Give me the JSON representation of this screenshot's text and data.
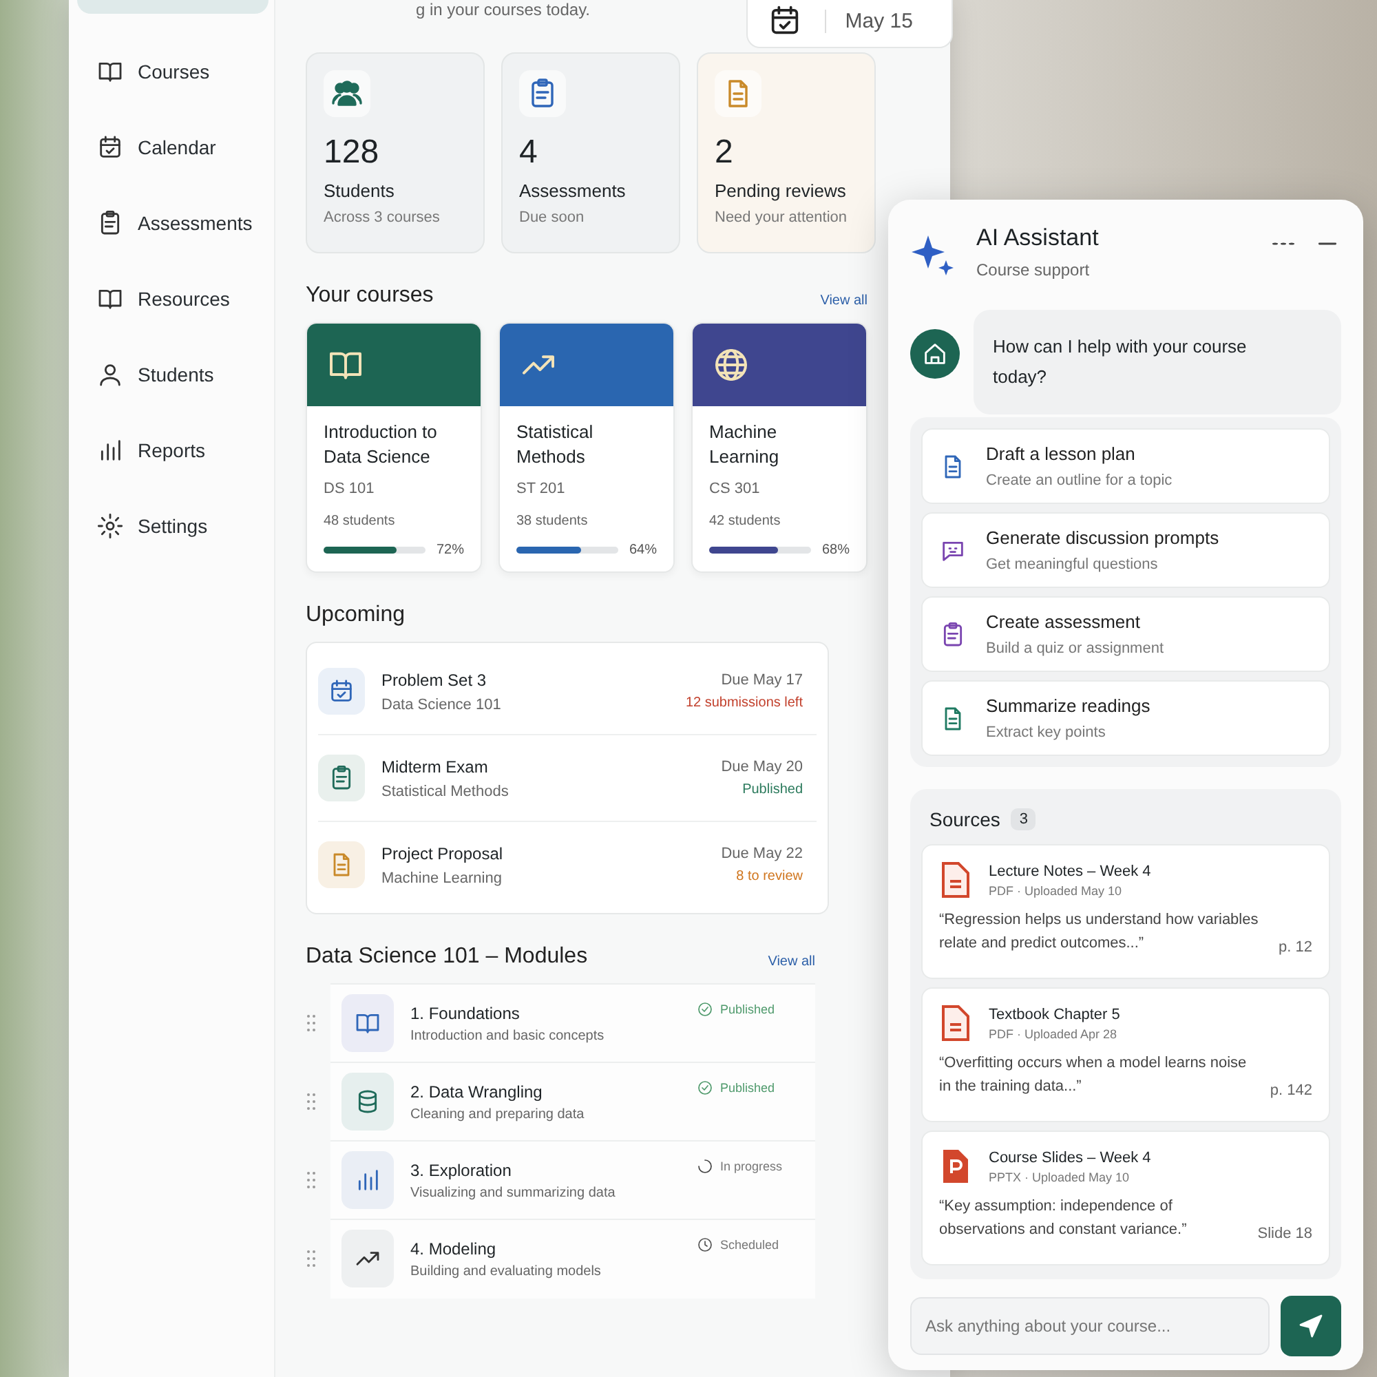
{
  "sidebar": {
    "items": [
      {
        "label": "Courses",
        "selected": false
      },
      {
        "label": "Calendar",
        "selected": false
      },
      {
        "label": "Assessments",
        "selected": false
      },
      {
        "label": "Resources",
        "selected": false
      },
      {
        "label": "Students",
        "selected": false
      },
      {
        "label": "Reports",
        "selected": false
      },
      {
        "label": "Settings",
        "selected": false
      }
    ]
  },
  "header": {
    "subtitle": "g in your courses today.",
    "date": "May 15"
  },
  "stats": [
    {
      "value": "128",
      "label": "Students",
      "note": "Across 3 courses",
      "color": "#1f6b5a"
    },
    {
      "value": "4",
      "label": "Assessments",
      "note": "Due soon",
      "color": "#2f66b8"
    },
    {
      "value": "2",
      "label": "Pending reviews",
      "note": "Need your attention",
      "color": "#c98a2a"
    }
  ],
  "courses": {
    "title": "Your courses",
    "view_all": "View all",
    "items": [
      {
        "title": "Introduction to Data Science",
        "code": "DS 101",
        "students": "48 students",
        "progress": "72%",
        "level": 0.72,
        "color": "#1d6553"
      },
      {
        "title": "Statistical Methods",
        "code": "ST 201",
        "students": "38 students",
        "progress": "64%",
        "level": 0.64,
        "color": "#2a66b0"
      },
      {
        "title": "Machine Learning",
        "code": "CS 301",
        "students": "42 students",
        "progress": "68%",
        "level": 0.68,
        "color": "#3f468f"
      }
    ]
  },
  "upcoming": {
    "title": "Upcoming",
    "items": [
      {
        "title": "Problem Set 3",
        "course": "Data Science 101",
        "due": "Due May 17",
        "note": "12 submissions left",
        "color": "#c2412d"
      },
      {
        "title": "Midterm Exam",
        "course": "Statistical Methods",
        "due": "Due May 20",
        "note": "Published",
        "color": "#2b7a5c"
      },
      {
        "title": "Project Proposal",
        "course": "Machine Learning",
        "due": "Due May 22",
        "note": "8 to review",
        "color": "#d0761f"
      }
    ]
  },
  "modules": {
    "title": "Data Science 101 – Modules",
    "view_all": "View all",
    "items": [
      {
        "title": "1. Foundations",
        "description": "Introduction and basic concepts",
        "status": "Published",
        "kind": "published"
      },
      {
        "title": "2. Data Wrangling",
        "description": "Cleaning and preparing data",
        "status": "Published",
        "kind": "published"
      },
      {
        "title": "3. Exploration",
        "description": "Visualizing and summarizing data",
        "status": "In progress",
        "kind": "progress"
      },
      {
        "title": "4. Modeling",
        "description": "Building and evaluating models",
        "status": "Scheduled",
        "kind": "scheduled"
      }
    ]
  },
  "assistant": {
    "title": "AI Assistant",
    "subtitle": "Course support",
    "message": "How can I help with your course today?",
    "suggestions": [
      {
        "title": "Draft a lesson plan",
        "description": "Create an outline for a topic",
        "color": "#2f66b8"
      },
      {
        "title": "Generate discussion prompts",
        "description": "Get meaningful questions",
        "color": "#7a45b0"
      },
      {
        "title": "Create assessment",
        "description": "Build a quiz or assignment",
        "color": "#7a45b0"
      },
      {
        "title": "Summarize readings",
        "description": "Extract key points",
        "color": "#1f7a62"
      }
    ],
    "sources": {
      "title": "Sources",
      "count": "3",
      "items": [
        {
          "title": "Lecture Notes – Week 4",
          "meta": "PDF · Uploaded May 10",
          "quote": "“Regression helps us understand how variables relate and predict outcomes...”",
          "location": "p. 12",
          "kind": "pdf"
        },
        {
          "title": "Textbook Chapter 5",
          "meta": "PDF · Uploaded Apr 28",
          "quote": "“Overfitting occurs when a model learns noise in the training data...”",
          "location": "p. 142",
          "kind": "pdf"
        },
        {
          "title": "Course Slides – Week 4",
          "meta": "PPTX · Uploaded May 10",
          "quote": "“Key assumption: independence of observations and constant variance.”",
          "location": "Slide 18",
          "kind": "pptx"
        }
      ]
    },
    "input": {
      "placeholder": "Ask anything about your course..."
    }
  }
}
